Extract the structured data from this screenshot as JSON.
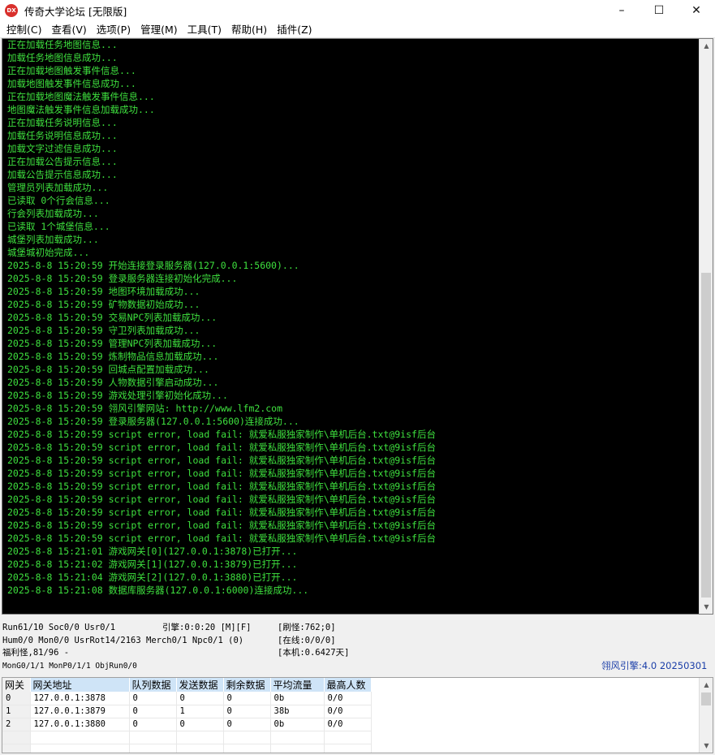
{
  "window": {
    "icon_text": "DX",
    "title": "传奇大学论坛 [无限版]",
    "minimize": "–",
    "maximize": "☐",
    "close": "✕"
  },
  "menu": [
    "控制(C)",
    "查看(V)",
    "选项(P)",
    "管理(M)",
    "工具(T)",
    "帮助(H)",
    "插件(Z)"
  ],
  "console_lines": [
    "正在加载任务地图信息...",
    "加载任务地图信息成功...",
    "正在加载地图触发事件信息...",
    "加载地图触发事件信息成功...",
    "正在加载地图魔法触发事件信息...",
    "地图魔法触发事件信息加载成功...",
    "正在加载任务说明信息...",
    "加载任务说明信息成功...",
    "加载文字过滤信息成功...",
    "正在加载公告提示信息...",
    "加载公告提示信息成功...",
    "管理员列表加载成功...",
    "已读取 0个行会信息...",
    "行会列表加载成功...",
    "已读取 1个城堡信息...",
    "城堡列表加载成功...",
    "城堡城初始完成...",
    "2025-8-8 15:20:59 开始连接登录服务器(127.0.0.1:5600)...",
    "2025-8-8 15:20:59 登录服务器连接初始化完成...",
    "2025-8-8 15:20:59 地图环境加载成功...",
    "2025-8-8 15:20:59 矿物数据初始成功...",
    "2025-8-8 15:20:59 交易NPC列表加载成功...",
    "2025-8-8 15:20:59 守卫列表加载成功...",
    "2025-8-8 15:20:59 管理NPC列表加载成功...",
    "2025-8-8 15:20:59 炼制物品信息加载成功...",
    "2025-8-8 15:20:59 回城点配置加载成功...",
    "2025-8-8 15:20:59 人物数据引擎启动成功...",
    "2025-8-8 15:20:59 游戏处理引擎初始化成功...",
    "2025-8-8 15:20:59 翎风引擎网站: http://www.lfm2.com",
    "2025-8-8 15:20:59 登录服务器(127.0.0.1:5600)连接成功...",
    "2025-8-8 15:20:59 script error, load fail: 就爱私服独家制作\\单机后台.txt@9isf后台",
    "2025-8-8 15:20:59 script error, load fail: 就爱私服独家制作\\单机后台.txt@9isf后台",
    "2025-8-8 15:20:59 script error, load fail: 就爱私服独家制作\\单机后台.txt@9isf后台",
    "2025-8-8 15:20:59 script error, load fail: 就爱私服独家制作\\单机后台.txt@9isf后台",
    "2025-8-8 15:20:59 script error, load fail: 就爱私服独家制作\\单机后台.txt@9isf后台",
    "2025-8-8 15:20:59 script error, load fail: 就爱私服独家制作\\单机后台.txt@9isf后台",
    "2025-8-8 15:20:59 script error, load fail: 就爱私服独家制作\\单机后台.txt@9isf后台",
    "2025-8-8 15:20:59 script error, load fail: 就爱私服独家制作\\单机后台.txt@9isf后台",
    "2025-8-8 15:20:59 script error, load fail: 就爱私服独家制作\\单机后台.txt@9isf后台",
    "2025-8-8 15:21:01 游戏网关[0](127.0.0.1:3878)已打开...",
    "2025-8-8 15:21:02 游戏网关[1](127.0.0.1:3879)已打开...",
    "2025-8-8 15:21:04 游戏网关[2](127.0.0.1:3880)已打开...",
    "2025-8-8 15:21:08 数据库服务器(127.0.0.1:6000)连接成功..."
  ],
  "status": {
    "run": "Run61/10 Soc0/0 Usr0/1",
    "engine": "引擎:0:0:20 [M][F]",
    "refresh": "[刷怪:762;0]",
    "hum": "Hum0/0 Mon0/0 UsrRot14/2163 Merch0/1 Npc0/1 (0)",
    "online": "[在线:0/0/0]",
    "welfare": "福利怪,81/96 -",
    "local": "[本机:0.6427天]",
    "mong": "MonG0/1/1 MonP0/1/1 ObjRun0/0",
    "version": "翎风引擎:4.0 20250301"
  },
  "gateway": {
    "headers": [
      "网关",
      "网关地址",
      "队列数据",
      "发送数据",
      "剩余数据",
      "平均流量",
      "最高人数"
    ],
    "rows": [
      [
        "0",
        "127.0.0.1:3878",
        "0",
        "0",
        "0",
        "0b",
        "0/0"
      ],
      [
        "1",
        "127.0.0.1:3879",
        "0",
        "1",
        "0",
        "38b",
        "0/0"
      ],
      [
        "2",
        "127.0.0.1:3880",
        "0",
        "0",
        "0",
        "0b",
        "0/0"
      ]
    ]
  }
}
